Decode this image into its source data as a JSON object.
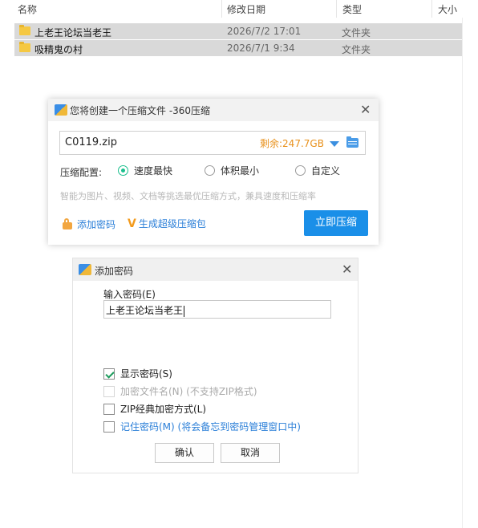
{
  "explorer": {
    "columns": {
      "name": "名称",
      "modified": "修改日期",
      "type": "类型",
      "size": "大小"
    },
    "files": [
      {
        "name": "上老王论坛当老王",
        "modified": "2026/7/2 17:01",
        "type": "文件夹",
        "icon": "folder-icon"
      },
      {
        "name": "吸精鬼の村",
        "modified": "2026/7/1 9:34",
        "type": "文件夹",
        "icon": "folder-icon"
      }
    ]
  },
  "compress_dialog": {
    "title": "您将创建一个压缩文件 -360压缩",
    "filename": "C0119.zip",
    "free_space": "剩余:247.7GB",
    "config_label": "压缩配置:",
    "options": [
      {
        "label": "速度最快",
        "selected": true
      },
      {
        "label": "体积最小",
        "selected": false
      },
      {
        "label": "自定义",
        "selected": false
      }
    ],
    "hint": "智能为图片、视频、文档等挑选最优压缩方式，兼具速度和压缩率",
    "add_password_link": "添加密码",
    "sfx_link": "生成超级压缩包",
    "compress_button": "立即压缩",
    "colors": {
      "accent": "#1a8fe8",
      "free_space": "#e8901a",
      "radio_on": "#1bbf8d"
    }
  },
  "password_dialog": {
    "title": "添加密码",
    "input_label": "输入密码(E)",
    "password_value": "上老王论坛当老王",
    "checkboxes": [
      {
        "label": "显示密码(S)",
        "checked": true,
        "enabled": true
      },
      {
        "label": "加密文件名(N) (不支持ZIP格式)",
        "checked": false,
        "enabled": false
      },
      {
        "label": "ZIP经典加密方式(L)",
        "checked": false,
        "enabled": true
      },
      {
        "label": "记住密码(M) (将会备忘到密码管理窗口中)",
        "checked": false,
        "enabled": true
      }
    ],
    "ok_button": "确认",
    "cancel_button": "取消"
  }
}
